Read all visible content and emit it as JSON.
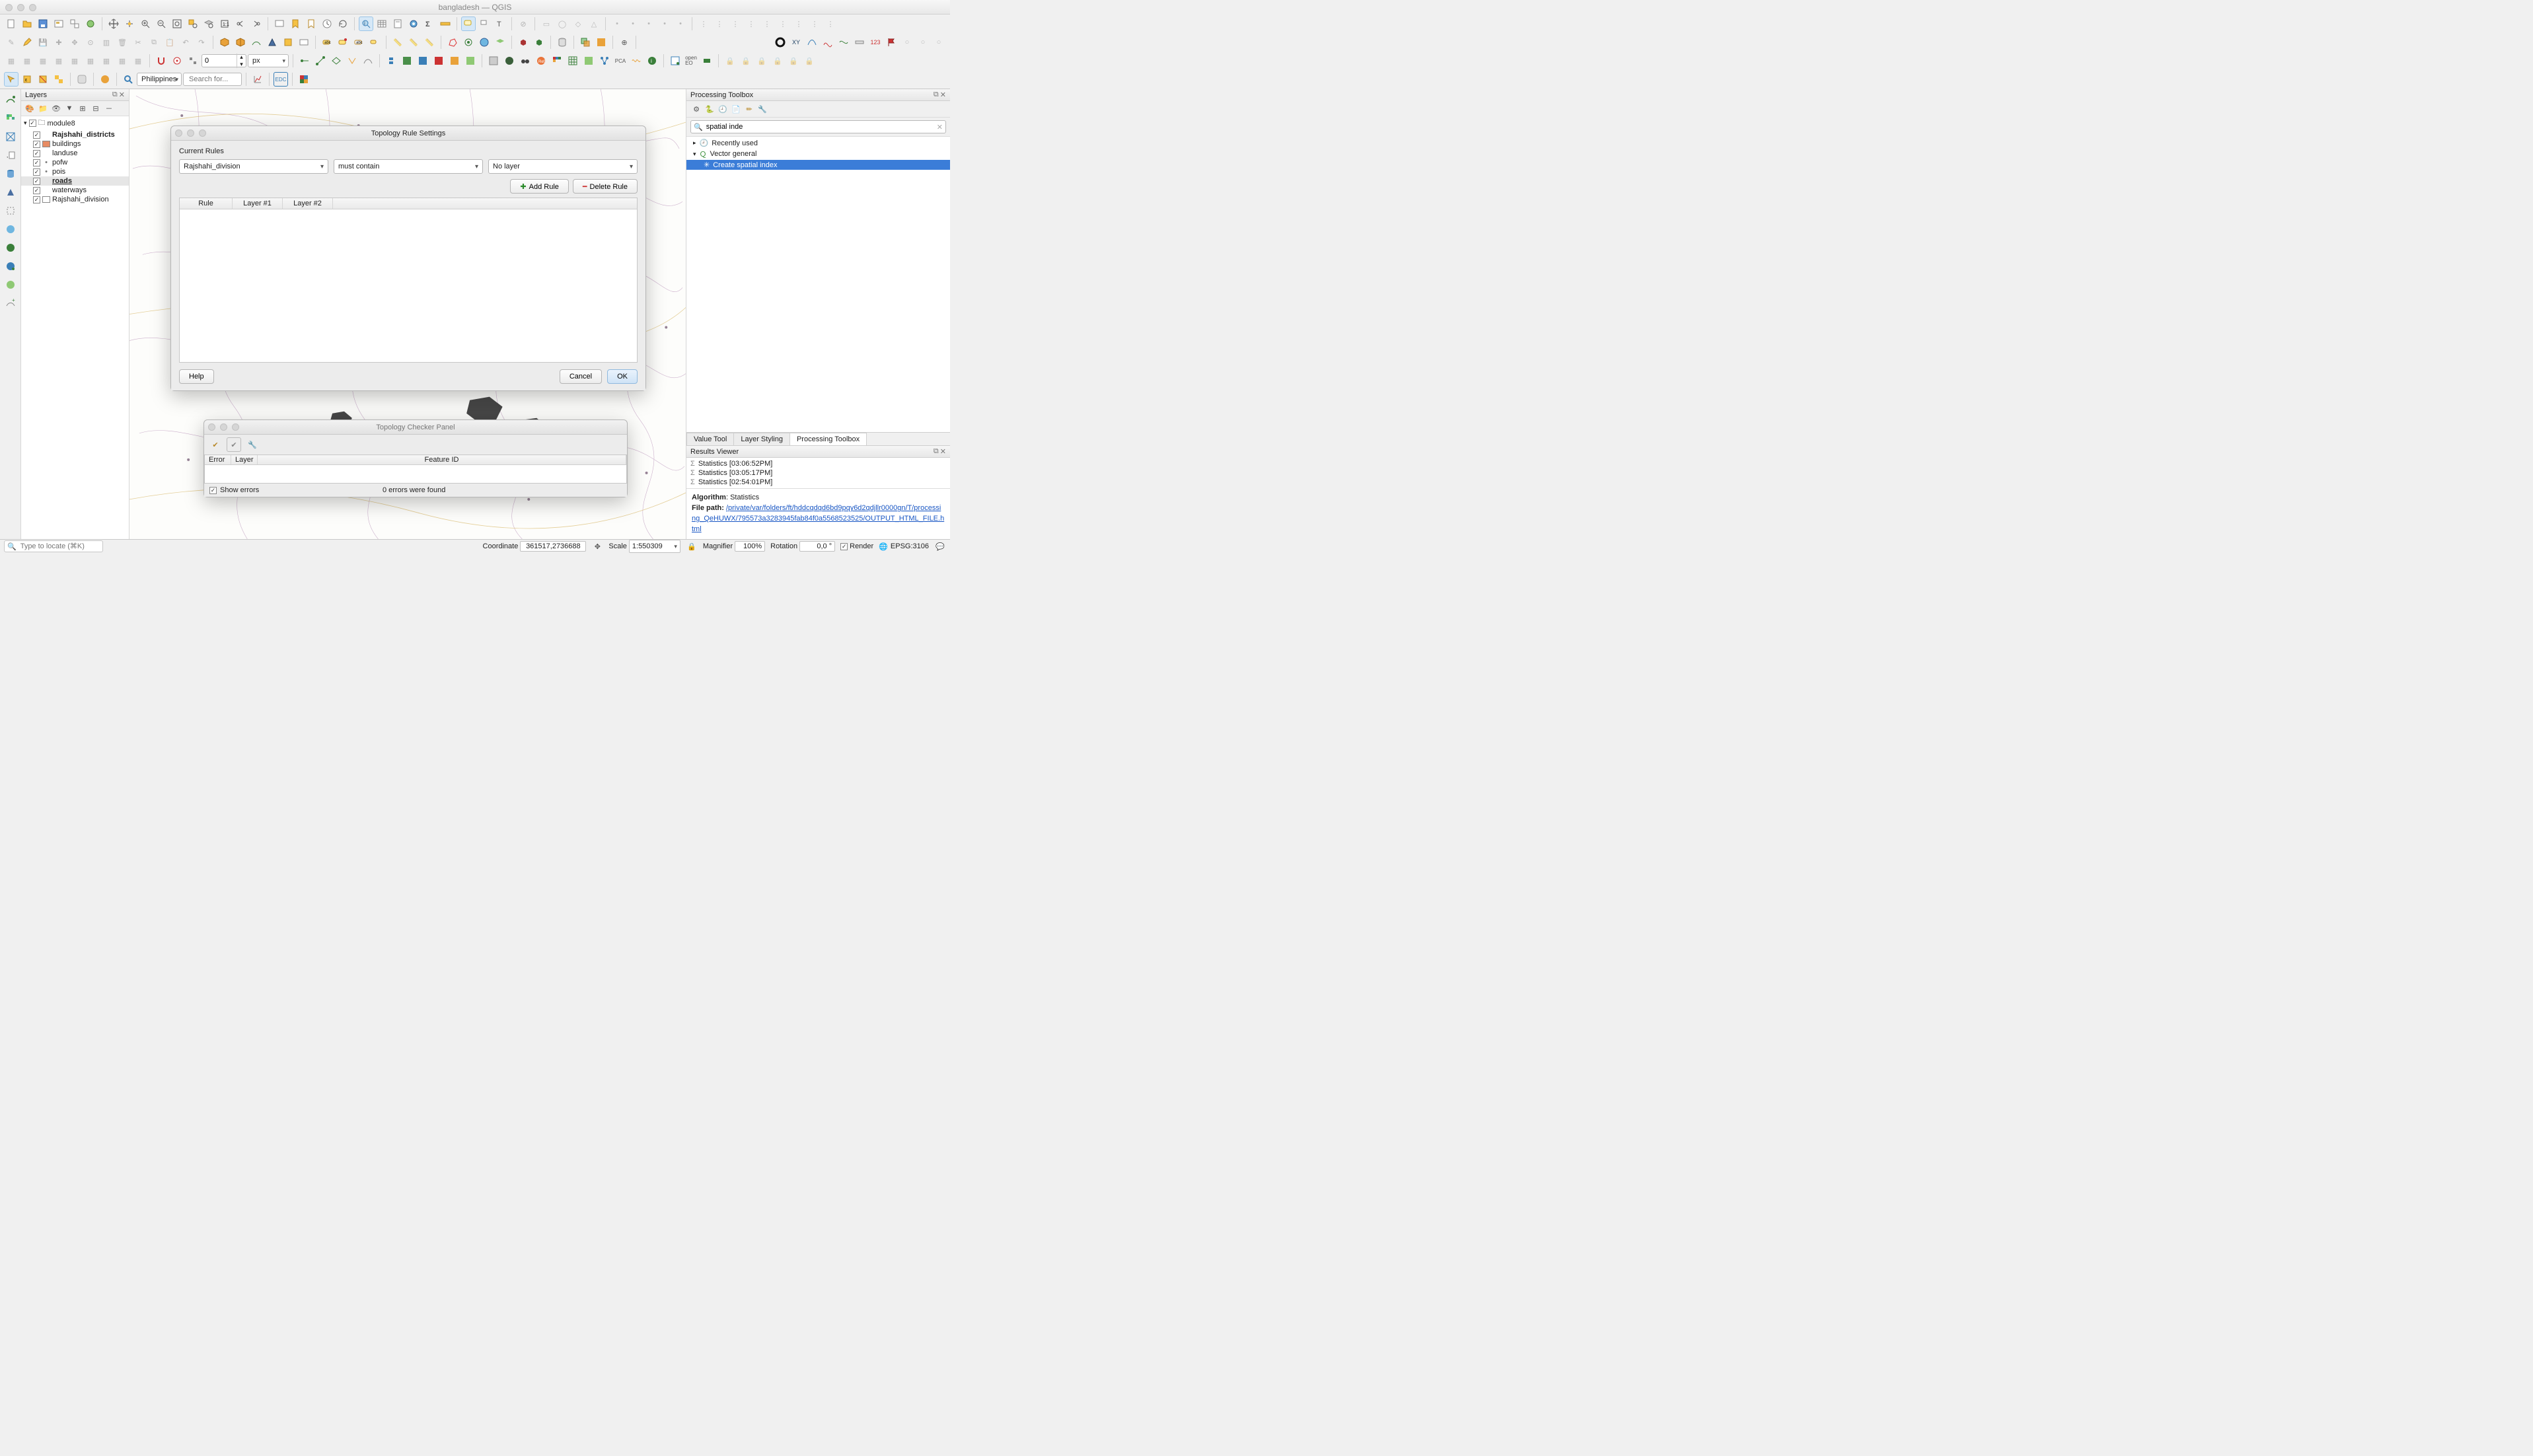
{
  "window": {
    "title": "bangladesh — QGIS"
  },
  "nominatim": {
    "country": "Philippines",
    "placeholder": "Search for..."
  },
  "snap": {
    "distance": "0",
    "unit": "px"
  },
  "layers_panel": {
    "title": "Layers",
    "group": "module8",
    "items": [
      {
        "name": "Rajshahi_districts",
        "bold": true,
        "checked": true,
        "swatch": ""
      },
      {
        "name": "buildings",
        "checked": true,
        "swatch": "#e78b63"
      },
      {
        "name": "landuse",
        "checked": true,
        "swatch": ""
      },
      {
        "name": "pofw",
        "checked": true,
        "dot": "#7a7a7a"
      },
      {
        "name": "pois",
        "checked": true,
        "dot": "#7a7a7a"
      },
      {
        "name": "roads",
        "checked": true,
        "bold": true,
        "underline": true,
        "selected": true
      },
      {
        "name": "waterways",
        "checked": true
      }
    ],
    "standalone": {
      "name": "Rajshahi_division",
      "checked": true,
      "swatch": "#ffffff"
    }
  },
  "topology_dialog": {
    "title": "Topology Rule Settings",
    "section": "Current Rules",
    "layer1": "Rajshahi_division",
    "rule": "must contain",
    "layer2": "No layer",
    "add_rule": "Add Rule",
    "delete_rule": "Delete Rule",
    "cols": {
      "rule": "Rule",
      "l1": "Layer #1",
      "l2": "Layer #2"
    },
    "help": "Help",
    "cancel": "Cancel",
    "ok": "OK"
  },
  "topology_checker": {
    "title": "Topology Checker Panel",
    "cols": {
      "error": "Error",
      "layer": "Layer",
      "feature": "Feature ID"
    },
    "show_errors": "Show errors",
    "status": "0 errors were found"
  },
  "processing": {
    "title": "Processing Toolbox",
    "search": "spatial inde",
    "recent": "Recently used",
    "group": "Vector general",
    "alg": "Create spatial index",
    "tabs": {
      "value": "Value Tool",
      "style": "Layer Styling",
      "proc": "Processing Toolbox"
    }
  },
  "results": {
    "title": "Results Viewer",
    "items": [
      "Statistics [03:06:52PM]",
      "Statistics [03:05:17PM]",
      "Statistics [02:54:01PM]"
    ],
    "algo_label": "Algorithm",
    "algo_value": "Statistics",
    "path_label": "File path:",
    "path": "/private/var/folders/ft/hddcqdqd6bd9pqy6d2qdjllr0000gn/T/processing_QeHUWX/795573a3283945fab84f0a5568523525/OUTPUT_HTML_FILE.html"
  },
  "status": {
    "locator_placeholder": "Type to locate (⌘K)",
    "coord_label": "Coordinate",
    "coord": "361517,2736688",
    "scale_label": "Scale",
    "scale": "1:550309",
    "mag_label": "Magnifier",
    "mag": "100%",
    "rot_label": "Rotation",
    "rot": "0,0 °",
    "render": "Render",
    "epsg": "EPSG:3106"
  }
}
